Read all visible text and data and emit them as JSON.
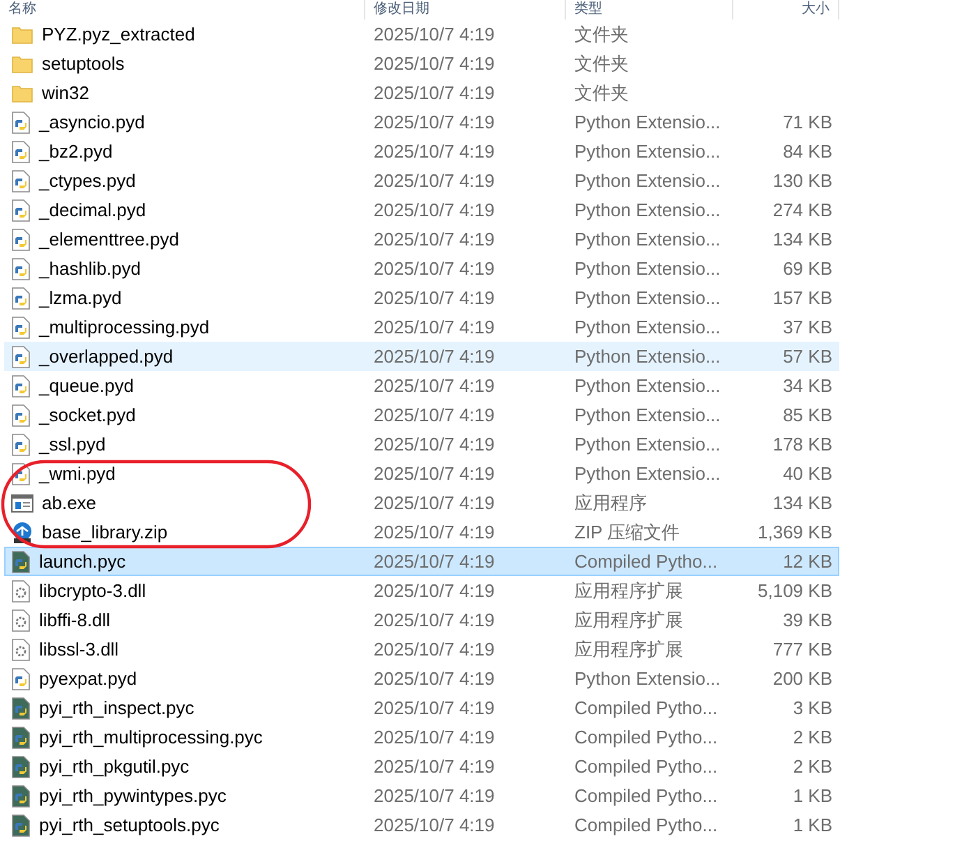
{
  "columns": [
    {
      "label": "名称"
    },
    {
      "label": "修改日期"
    },
    {
      "label": "类型"
    },
    {
      "label": "大小"
    }
  ],
  "rows": [
    {
      "kind": "folder",
      "name": "PYZ.pyz_extracted",
      "date": "2025/10/7 4:19",
      "type": "文件夹",
      "selected": false,
      "hovered": false,
      "circled": false
    },
    {
      "kind": "folder",
      "name": "setuptools",
      "date": "2025/10/7 4:19",
      "type": "文件夹",
      "selected": false,
      "hovered": false,
      "circled": false
    },
    {
      "kind": "folder",
      "name": "win32",
      "date": "2025/10/7 4:19",
      "type": "文件夹",
      "selected": false,
      "hovered": false,
      "circled": false
    },
    {
      "kind": "pyd",
      "name": "_asyncio.pyd",
      "date": "2025/10/7 4:19",
      "type": "Python Extensio...",
      "size": "71 KB",
      "selected": false,
      "hovered": false,
      "circled": false
    },
    {
      "kind": "pyd",
      "name": "_bz2.pyd",
      "date": "2025/10/7 4:19",
      "type": "Python Extensio...",
      "size": "84 KB",
      "selected": false,
      "hovered": false,
      "circled": false
    },
    {
      "kind": "pyd",
      "name": "_ctypes.pyd",
      "date": "2025/10/7 4:19",
      "type": "Python Extensio...",
      "size": "130 KB",
      "selected": false,
      "hovered": false,
      "circled": false
    },
    {
      "kind": "pyd",
      "name": "_decimal.pyd",
      "date": "2025/10/7 4:19",
      "type": "Python Extensio...",
      "size": "274 KB",
      "selected": false,
      "hovered": false,
      "circled": false
    },
    {
      "kind": "pyd",
      "name": "_elementtree.pyd",
      "date": "2025/10/7 4:19",
      "type": "Python Extensio...",
      "size": "134 KB",
      "selected": false,
      "hovered": false,
      "circled": false
    },
    {
      "kind": "pyd",
      "name": "_hashlib.pyd",
      "date": "2025/10/7 4:19",
      "type": "Python Extensio...",
      "size": "69 KB",
      "selected": false,
      "hovered": false,
      "circled": false
    },
    {
      "kind": "pyd",
      "name": "_lzma.pyd",
      "date": "2025/10/7 4:19",
      "type": "Python Extensio...",
      "size": "157 KB",
      "selected": false,
      "hovered": false,
      "circled": false
    },
    {
      "kind": "pyd",
      "name": "_multiprocessing.pyd",
      "date": "2025/10/7 4:19",
      "type": "Python Extensio...",
      "size": "37 KB",
      "selected": false,
      "hovered": false,
      "circled": false
    },
    {
      "kind": "pyd",
      "name": "_overlapped.pyd",
      "date": "2025/10/7 4:19",
      "type": "Python Extensio...",
      "size": "57 KB",
      "selected": false,
      "hovered": true,
      "circled": false
    },
    {
      "kind": "pyd",
      "name": "_queue.pyd",
      "date": "2025/10/7 4:19",
      "type": "Python Extensio...",
      "size": "34 KB",
      "selected": false,
      "hovered": false,
      "circled": false
    },
    {
      "kind": "pyd",
      "name": "_socket.pyd",
      "date": "2025/10/7 4:19",
      "type": "Python Extensio...",
      "size": "85 KB",
      "selected": false,
      "hovered": false,
      "circled": false
    },
    {
      "kind": "pyd",
      "name": "_ssl.pyd",
      "date": "2025/10/7 4:19",
      "type": "Python Extensio...",
      "size": "178 KB",
      "selected": false,
      "hovered": false,
      "circled": false
    },
    {
      "kind": "pyd",
      "name": "_wmi.pyd",
      "date": "2025/10/7 4:19",
      "type": "Python Extensio...",
      "size": "40 KB",
      "selected": false,
      "hovered": false,
      "circled": true
    },
    {
      "kind": "exe",
      "name": "ab.exe",
      "date": "2025/10/7 4:19",
      "type": "应用程序",
      "size": "134 KB",
      "selected": false,
      "hovered": false,
      "circled": true
    },
    {
      "kind": "zip",
      "name": "base_library.zip",
      "date": "2025/10/7 4:19",
      "type": "ZIP 压缩文件",
      "size": "1,369 KB",
      "selected": false,
      "hovered": false,
      "circled": true
    },
    {
      "kind": "pyc",
      "name": "launch.pyc",
      "date": "2025/10/7 4:19",
      "type": "Compiled Pytho...",
      "size": "12 KB",
      "selected": true,
      "hovered": false,
      "circled": false
    },
    {
      "kind": "dll",
      "name": "libcrypto-3.dll",
      "date": "2025/10/7 4:19",
      "type": "应用程序扩展",
      "size": "5,109 KB",
      "selected": false,
      "hovered": false,
      "circled": false
    },
    {
      "kind": "dll",
      "name": "libffi-8.dll",
      "date": "2025/10/7 4:19",
      "type": "应用程序扩展",
      "size": "39 KB",
      "selected": false,
      "hovered": false,
      "circled": false
    },
    {
      "kind": "dll",
      "name": "libssl-3.dll",
      "date": "2025/10/7 4:19",
      "type": "应用程序扩展",
      "size": "777 KB",
      "selected": false,
      "hovered": false,
      "circled": false
    },
    {
      "kind": "pyd",
      "name": "pyexpat.pyd",
      "date": "2025/10/7 4:19",
      "type": "Python Extensio...",
      "size": "200 KB",
      "selected": false,
      "hovered": false,
      "circled": false
    },
    {
      "kind": "pyc",
      "name": "pyi_rth_inspect.pyc",
      "date": "2025/10/7 4:19",
      "type": "Compiled Pytho...",
      "size": "3 KB",
      "selected": false,
      "hovered": false,
      "circled": false
    },
    {
      "kind": "pyc",
      "name": "pyi_rth_multiprocessing.pyc",
      "date": "2025/10/7 4:19",
      "type": "Compiled Pytho...",
      "size": "2 KB",
      "selected": false,
      "hovered": false,
      "circled": false
    },
    {
      "kind": "pyc",
      "name": "pyi_rth_pkgutil.pyc",
      "date": "2025/10/7 4:19",
      "type": "Compiled Pytho...",
      "size": "2 KB",
      "selected": false,
      "hovered": false,
      "circled": false
    },
    {
      "kind": "pyc",
      "name": "pyi_rth_pywintypes.pyc",
      "date": "2025/10/7 4:19",
      "type": "Compiled Pytho...",
      "size": "1 KB",
      "selected": false,
      "hovered": false,
      "circled": false
    },
    {
      "kind": "pyc",
      "name": "pyi_rth_setuptools.pyc",
      "date": "2025/10/7 4:19",
      "type": "Compiled Pytho...",
      "size": "1 KB",
      "selected": false,
      "hovered": false,
      "circled": false
    }
  ]
}
